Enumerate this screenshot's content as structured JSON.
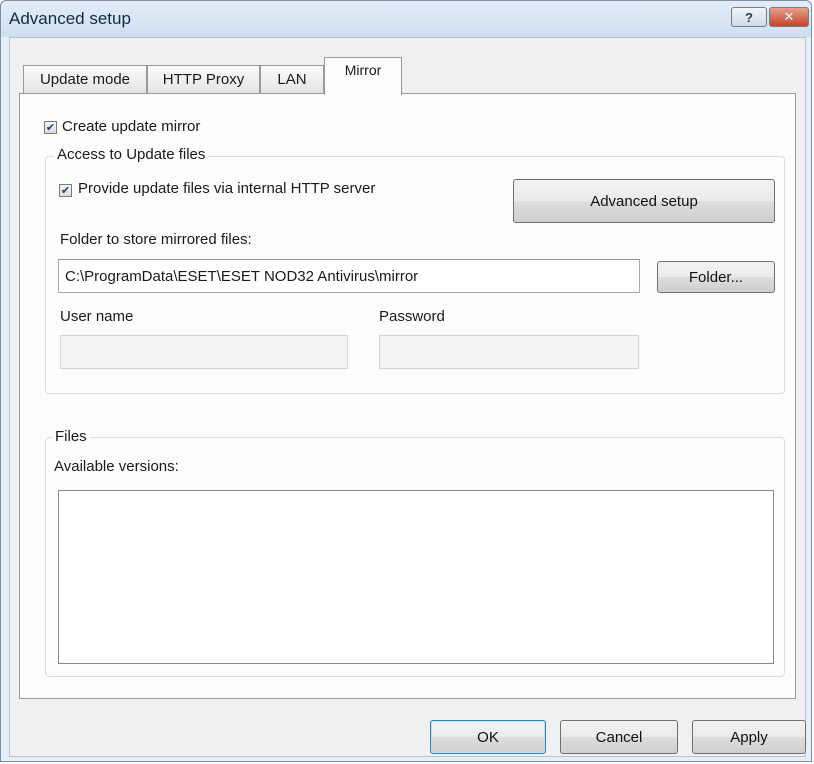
{
  "window": {
    "title": "Advanced setup",
    "help_label": "?",
    "close_label": "✕"
  },
  "tabs": [
    {
      "label": "Update mode"
    },
    {
      "label": "HTTP Proxy"
    },
    {
      "label": "LAN"
    },
    {
      "label": "Mirror",
      "active": true
    }
  ],
  "mirror": {
    "create_mirror": {
      "label": "Create update mirror",
      "checked": true
    },
    "access_group": {
      "title": "Access to Update files",
      "provide_http": {
        "label": "Provide update files via internal HTTP server",
        "checked": true
      },
      "advanced_setup_label": "Advanced setup",
      "folder_label": "Folder to store mirrored files:",
      "folder_value": "C:\\ProgramData\\ESET\\ESET NOD32 Antivirus\\mirror",
      "folder_button_label": "Folder...",
      "username_label": "User name",
      "username_value": "",
      "password_label": "Password",
      "password_value": ""
    },
    "files_group": {
      "title": "Files",
      "available_versions_label": "Available versions:"
    }
  },
  "footer": {
    "ok_label": "OK",
    "cancel_label": "Cancel",
    "apply_label": "Apply"
  },
  "colors": {
    "titlebar": "#cfdff0",
    "close_button": "#c2452a",
    "default_button_border": "#3c7fb1"
  }
}
